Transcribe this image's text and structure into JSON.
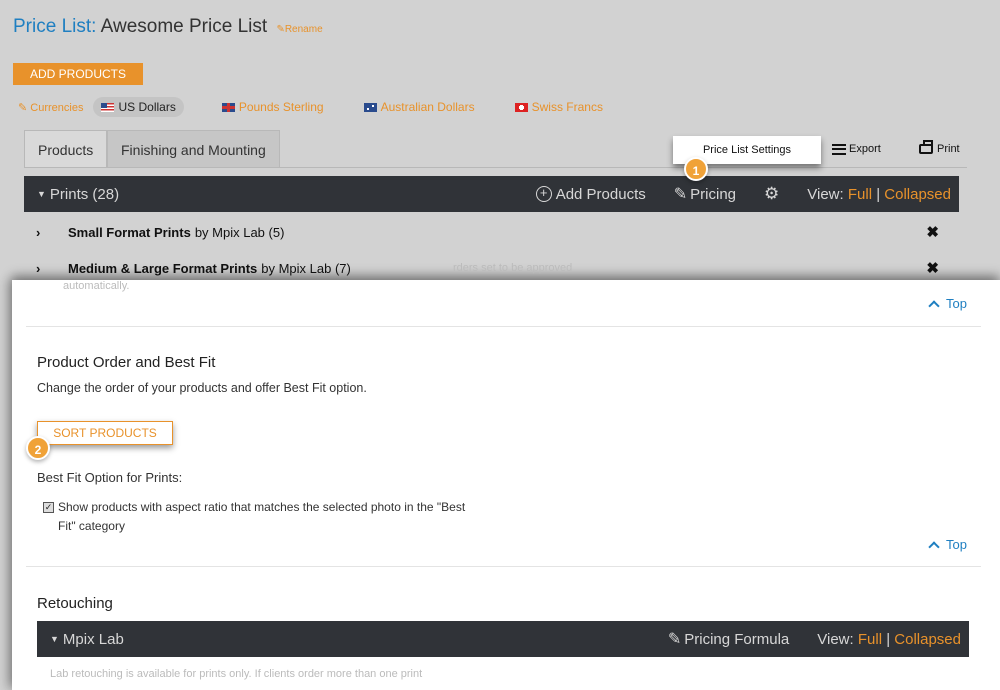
{
  "header": {
    "title_prefix": "Price List:",
    "title_name": "Awesome Price List",
    "rename_label": "Rename",
    "add_products_label": "ADD PRODUCTS"
  },
  "currencies": {
    "label": "Currencies",
    "items": [
      {
        "label": "US Dollars",
        "selected": true
      },
      {
        "label": "Pounds Sterling",
        "selected": false
      },
      {
        "label": "Australian Dollars",
        "selected": false
      },
      {
        "label": "Swiss Francs",
        "selected": false
      }
    ]
  },
  "tabs": [
    {
      "label": "Products",
      "active": true
    },
    {
      "label": "Finishing and Mounting",
      "active": false
    }
  ],
  "toolbar": {
    "price_list_settings": "Price List Settings",
    "export": "Export",
    "print": "Print"
  },
  "callouts": {
    "one": "1",
    "two": "2"
  },
  "prints_bar": {
    "title": "Prints (28)",
    "add_products": "Add Products",
    "pricing": "Pricing",
    "view_label": "View:",
    "view_full": "Full",
    "view_sep": "|",
    "view_collapsed": "Collapsed"
  },
  "product_rows": [
    {
      "name": "Small Format Prints",
      "by": "by Mpix Lab (5)"
    },
    {
      "name": "Medium & Large Format Prints",
      "by": "by Mpix Lab (7)"
    }
  ],
  "ghost_text": {
    "line1": "rders set to be approved",
    "line2": "automatically."
  },
  "top_link": "Top",
  "sort_section": {
    "title": "Product Order and Best Fit",
    "description": "Change the order of your products and offer Best Fit option.",
    "sort_button": "SORT PRODUCTS",
    "best_fit_label": "Best Fit Option for Prints:",
    "checkbox_label": "Show products with aspect ratio that matches the selected photo in the \"Best Fit\" category",
    "checkbox_checked": true
  },
  "retouching": {
    "title": "Retouching",
    "bar_title": "Mpix Lab",
    "pricing_formula": "Pricing Formula",
    "view_label": "View:",
    "view_full": "Full",
    "view_sep": "|",
    "view_collapsed": "Collapsed",
    "ghost": "Lab retouching is available for prints only. If clients order more than one print"
  },
  "colors": {
    "accent_orange": "#e8922b",
    "link_blue": "#1f7fc1",
    "dark_bar": "#303338"
  }
}
